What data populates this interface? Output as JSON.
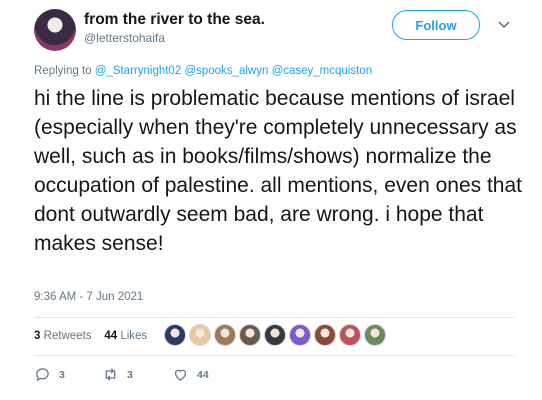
{
  "author": {
    "display_name": "from the river to the sea.",
    "handle": "@letterstohaifa",
    "avatar_icon": "profile-avatar"
  },
  "follow_label": "Follow",
  "reply_to": {
    "prefix": "Replying to",
    "mentions": [
      "@_Starrynight02",
      "@spooks_alwyn",
      "@casey_mcquiston"
    ]
  },
  "tweet_text": "hi the line is problematic because mentions of israel (especially when they're completely unnecessary as well, such as in books/films/shows) normalize the occupation of palestine. all mentions, even ones that dont outwardly seem bad, are wrong. i hope that makes sense!",
  "timestamp": "9:36 AM - 7 Jun 2021",
  "stats": {
    "retweets_count": "3",
    "retweets_label": "Retweets",
    "likes_count": "44",
    "likes_label": "Likes"
  },
  "liker_colors": [
    "#2a3a6a",
    "#e8c8a0",
    "#9a7a5a",
    "#6a5a4a",
    "#3a3a3a",
    "#7a5ad0",
    "#8a4a3a",
    "#c0505a",
    "#6a8a5a"
  ],
  "actions": {
    "reply_count": "3",
    "retweet_count": "3",
    "like_count": "44"
  },
  "colors": {
    "accent": "#1da1f2",
    "muted": "#657786"
  }
}
